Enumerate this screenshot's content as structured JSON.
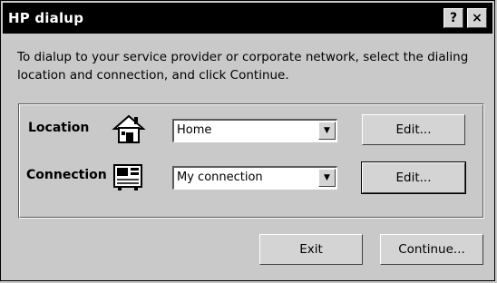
{
  "window": {
    "title": "HP dialup",
    "help_label": "?",
    "close_label": "×"
  },
  "instructions": "To dialup to your service provider or corporate network, select the dialing location and connection, and click Continue.",
  "location": {
    "label": "Location",
    "icon": "house-icon",
    "selected": "Home",
    "edit_label": "Edit..."
  },
  "connection": {
    "label": "Connection",
    "icon": "modem-icon",
    "selected": "My connection",
    "edit_label": "Edit..."
  },
  "footer": {
    "exit_label": "Exit",
    "continue_label": "Continue..."
  }
}
